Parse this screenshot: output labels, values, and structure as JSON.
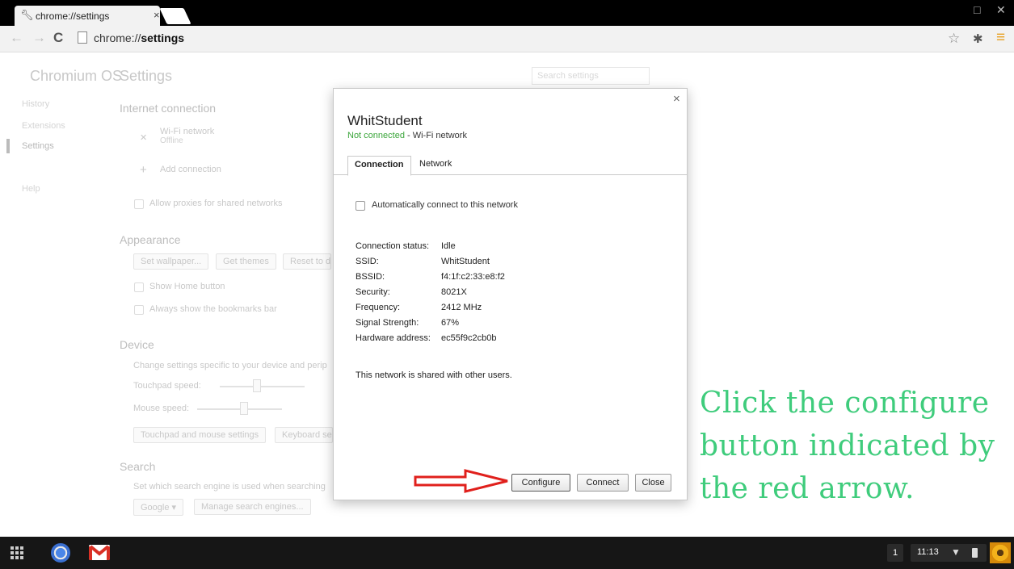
{
  "browser": {
    "tab_title": "chrome://settings",
    "address_prefix": "chrome://",
    "address_path": "settings"
  },
  "settings_bg": {
    "app_name": "Chromium OS",
    "page_title": "Settings",
    "search_placeholder": "Search settings",
    "sidebar": [
      "History",
      "Extensions",
      "Settings",
      "Help"
    ],
    "internet_heading": "Internet connection",
    "wifi_label": "Wi-Fi network",
    "wifi_status": "Offline",
    "add_connection": "Add connection",
    "allow_proxies": "Allow proxies for shared networks",
    "appearance_heading": "Appearance",
    "set_wallpaper": "Set wallpaper...",
    "get_themes": "Get themes",
    "reset_partial": "Reset to d",
    "show_home": "Show Home button",
    "bookmarks_bar": "Always show the bookmarks bar",
    "device_heading": "Device",
    "device_desc": "Change settings specific to your device and perip",
    "touchpad_speed": "Touchpad speed:",
    "mouse_speed": "Mouse speed:",
    "touchpad_settings": "Touchpad and mouse settings",
    "keyboard_partial": "Keyboard se",
    "search_heading": "Search",
    "search_desc": "Set which search engine is used when searching",
    "engine": "Google",
    "manage_engines": "Manage search engines..."
  },
  "dialog": {
    "title": "WhitStudent",
    "status": "Not connected",
    "status_suffix": " - Wi-Fi network",
    "status_color": "#3aa53a",
    "tabs": [
      "Connection",
      "Network"
    ],
    "auto_connect": "Automatically connect to this network",
    "details": [
      {
        "label": "Connection status:",
        "value": "Idle"
      },
      {
        "label": "SSID:",
        "value": "WhitStudent"
      },
      {
        "label": "BSSID:",
        "value": "f4:1f:c2:33:e8:f2"
      },
      {
        "label": "Security:",
        "value": "8021X"
      },
      {
        "label": "Frequency:",
        "value": "2412 MHz"
      },
      {
        "label": "Signal Strength:",
        "value": "67%"
      },
      {
        "label": "Hardware address:",
        "value": "ec55f9c2cb0b"
      }
    ],
    "shared_note": "This network is shared with other users.",
    "configure": "Configure",
    "connect": "Connect",
    "close": "Close"
  },
  "annotation": {
    "text": "Click the configure button indicated by the red arrow.",
    "color": "#3fcc7c",
    "arrow_color": "#e0201c"
  },
  "shelf": {
    "notification_count": "1",
    "time": "11:13"
  }
}
